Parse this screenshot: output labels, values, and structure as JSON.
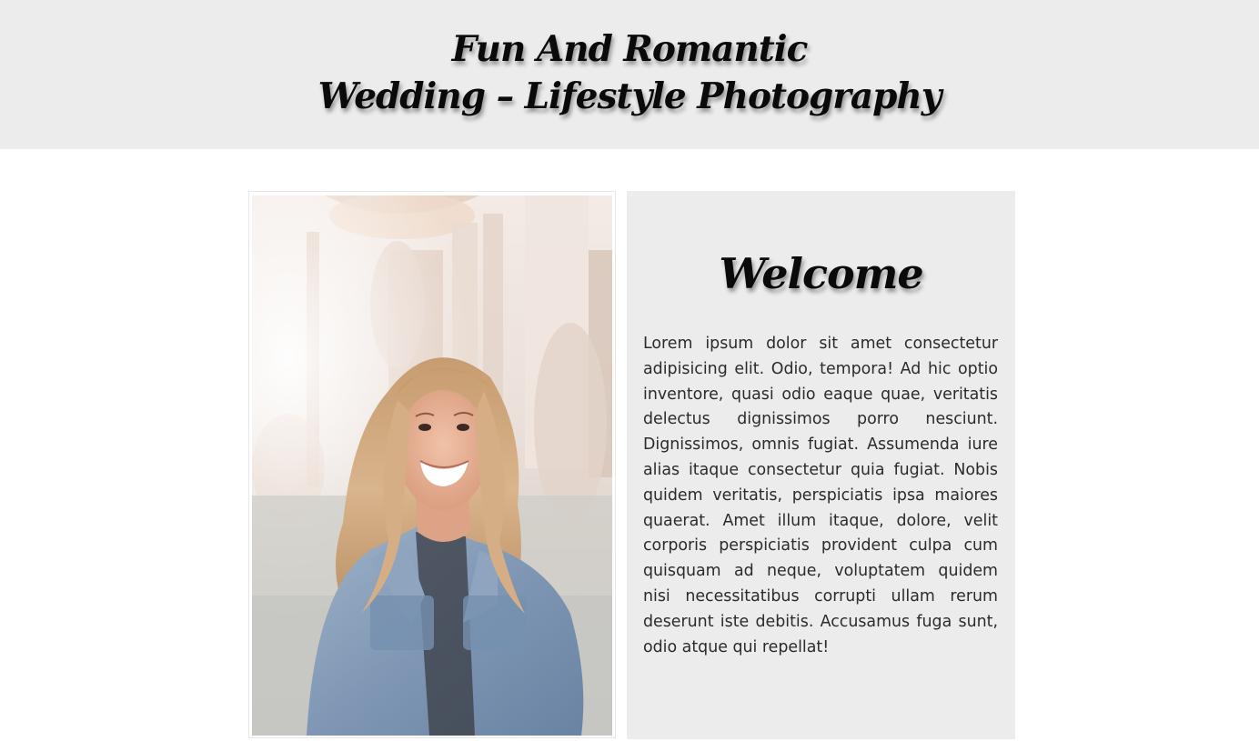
{
  "header": {
    "title_line1": "Fun And Romantic",
    "title_line2": "Wedding – Lifestyle Photography"
  },
  "photo": {
    "alt": "Smiling woman with long blonde hair wearing a denim jacket, sitting in front of a fountain with marble statues"
  },
  "welcome": {
    "heading": "Welcome",
    "body": "Lorem ipsum dolor sit amet consectetur adipisicing elit. Odio, tempora! Ad hic optio inventore, quasi odio eaque quae, veritatis delectus dignissimos porro nesciunt. Dignissimos, omnis fugiat. Assumenda iure alias itaque consectetur quia fugiat. Nobis quidem veritatis, perspiciatis ipsa maiores quaerat. Amet illum itaque, dolore, velit corporis perspiciatis provident culpa cum quisquam ad neque, voluptatem quidem nisi necessitatibus corrupti ullam rerum deserunt iste debitis. Accusamus fuga sunt, odio atque qui repellat!"
  },
  "colors": {
    "band_background": "#ececec",
    "page_background": "#ffffff",
    "heading_text": "#0a0a0a",
    "body_text": "#2b2b2b"
  }
}
